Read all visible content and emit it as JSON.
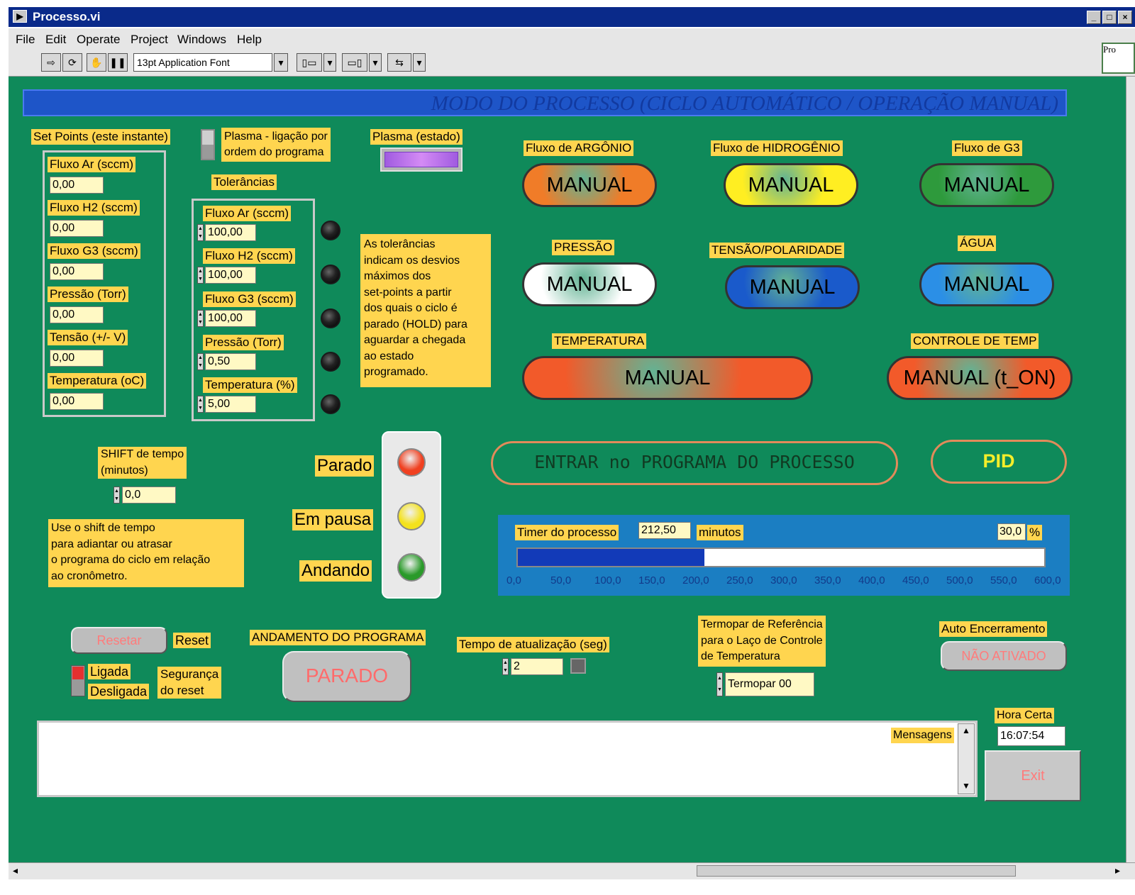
{
  "window": {
    "title": "Processo.vi",
    "min_label": "_",
    "max_label": "□",
    "close_label": "×",
    "thumb_label": "Pro"
  },
  "menu": [
    "File",
    "Edit",
    "Operate",
    "Project",
    "Windows",
    "Help"
  ],
  "toolbar": {
    "run": "⇨",
    "run_cont": "⟳",
    "abort": "✋",
    "pause": "❚❚",
    "font": "13pt Application Font",
    "align": "▯▭",
    "distribute": "▭▯",
    "reorder": "⇆",
    "drop": "▾"
  },
  "banner": "MODO DO PROCESSO (CICLO AUTOMÁTICO / OPERAÇÃO MANUAL)",
  "setpoints": {
    "title": "Set Points (este instante)",
    "items": [
      {
        "label": "Fluxo Ar (sccm)",
        "value": "0,00"
      },
      {
        "label": "Fluxo H2 (sccm)",
        "value": "0,00"
      },
      {
        "label": "Fluxo G3 (sccm)",
        "value": "0,00"
      },
      {
        "label": "Pressão (Torr)",
        "value": "0,00"
      },
      {
        "label": "Tensão (+/- V)",
        "value": "0,00"
      },
      {
        "label": "Temperatura (oC)",
        "value": "0,00"
      }
    ]
  },
  "plasma_switch_label": "Plasma - ligação por\nordem do programa",
  "plasma_state_label": "Plasma (estado)",
  "tolerances": {
    "title": "Tolerâncias",
    "items": [
      {
        "label": "Fluxo Ar (sccm)",
        "value": "100,00"
      },
      {
        "label": "Fluxo H2 (sccm)",
        "value": "100,00"
      },
      {
        "label": "Fluxo G3 (sccm)",
        "value": "100,00"
      },
      {
        "label": "Pressão (Torr)",
        "value": "0,50"
      },
      {
        "label": "Temperatura (%)",
        "value": "5,00"
      }
    ],
    "note": "As tolerâncias\nindicam os desvios\nmáximos dos\nset-points a partir\ndos quais o ciclo  é\nparado (HOLD) para\naguardar a chegada\nao estado\nprogramado."
  },
  "modes": {
    "argon": {
      "label": "Fluxo de ARGÔNIO",
      "value": "MANUAL",
      "color": "#f07c28"
    },
    "hidrogenio": {
      "label": "Fluxo de HIDROGÊNIO",
      "value": "MANUAL",
      "color": "#ffee22"
    },
    "g3": {
      "label": "Fluxo de G3",
      "value": "MANUAL",
      "color": "#2e9a3c"
    },
    "pressao": {
      "label": "PRESSÃO",
      "value": "MANUAL",
      "color": "#ffffff"
    },
    "tensao": {
      "label": "TENSÃO/POLARIDADE",
      "value": "MANUAL",
      "color": "#1a5acb"
    },
    "agua": {
      "label": "ÁGUA",
      "value": "MANUAL",
      "color": "#2b8fe6"
    },
    "temperatura": {
      "label": "TEMPERATURA",
      "value": "MANUAL",
      "color": "#f25a2a"
    },
    "controle": {
      "label": "CONTROLE DE TEMP",
      "value": "MANUAL (t_ON)",
      "color": "#f25a2a"
    }
  },
  "shift": {
    "label": "SHIFT de tempo\n(minutos)",
    "value": "0,0",
    "note": "Use o shift de tempo\npara adiantar ou atrasar\no programa do ciclo em relação\nao cronômetro."
  },
  "status_lights": {
    "stopped": "Parado",
    "paused": "Em pausa",
    "running": "Andando",
    "stopped_color": "#f04020",
    "paused_color": "#f4e21c",
    "running_color": "#2a9a2a"
  },
  "enter_program": "ENTRAR no PROGRAMA DO PROCESSO",
  "pid": "PID",
  "timer": {
    "label": "Timer do processo",
    "value": "212,50",
    "unit": "minutos",
    "percent": "30,0",
    "percent_sign": "%",
    "progress": 212.5,
    "min": 0,
    "max": 600,
    "ticks": [
      "0,0",
      "50,0",
      "100,0",
      "150,0",
      "200,0",
      "250,0",
      "300,0",
      "350,0",
      "400,0",
      "450,0",
      "500,0",
      "550,0",
      "600,0"
    ]
  },
  "reset": {
    "button": "Resetar",
    "label": "Reset",
    "on": "Ligada",
    "off": "Desligada",
    "safety": "Segurança\ndo reset"
  },
  "program_status": {
    "label": "ANDAMENTO DO PROGRAMA",
    "value": "PARADO"
  },
  "update_time": {
    "label": "Tempo de atualização (seg)",
    "value": "2"
  },
  "thermocouple": {
    "label": "Termopar de Referência\npara o Laço de Controle\nde Temperatura",
    "value": "Termopar 00"
  },
  "auto_shutdown": {
    "label": "Auto Encerramento",
    "value": "NÃO ATIVADO"
  },
  "messages": {
    "label": "Mensagens",
    "text": ""
  },
  "clock": {
    "label": "Hora Certa",
    "value": "16:07:54"
  },
  "exit_label": "Exit",
  "scroll": {
    "up": "▲",
    "down": "▼",
    "left": "◂",
    "right": "▸"
  }
}
